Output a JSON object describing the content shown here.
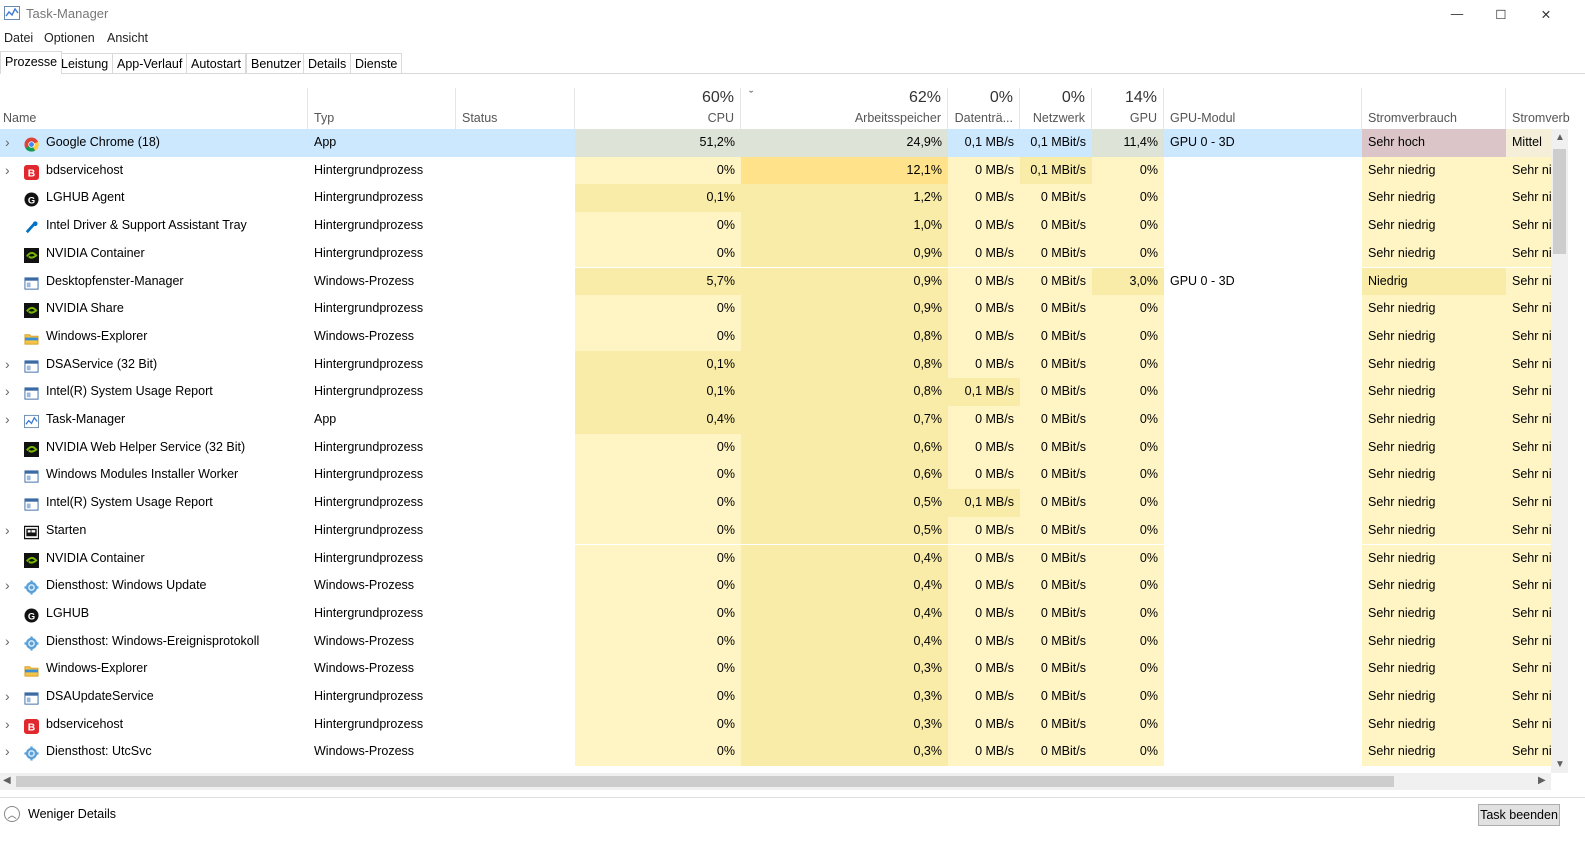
{
  "window": {
    "title": "Task-Manager",
    "minimize": "—",
    "maximize": "☐",
    "close": "✕"
  },
  "menu": [
    "Datei",
    "Optionen",
    "Ansicht"
  ],
  "tabs": [
    "Prozesse",
    "Leistung",
    "App-Verlauf",
    "Autostart",
    "Benutzer",
    "Details",
    "Dienste"
  ],
  "header": {
    "name": "Name",
    "type": "Typ",
    "status": "Status",
    "cpu_pct": "60%",
    "cpu": "CPU",
    "sort_indicator": "ˇ",
    "mem_pct": "62%",
    "mem": "Arbeitsspeicher",
    "disk_pct": "0%",
    "disk": "Datenträ...",
    "net_pct": "0%",
    "net": "Netzwerk",
    "gpu_pct": "14%",
    "gpu": "GPU",
    "gpu_engine": "GPU-Modul",
    "power": "Stromverbrauch",
    "power_trend": "Stromverb"
  },
  "rows": [
    {
      "expand": true,
      "icon": "chrome-icon",
      "name": "Google Chrome (18)",
      "type": "App",
      "cpu": "51,2%",
      "mem": "24,9%",
      "disk": "0,1 MB/s",
      "net": "0,1 MBit/s",
      "gpu": "11,4%",
      "engine": "GPU 0 - 3D",
      "power": "Sehr hoch",
      "trend": "Mittel",
      "selected": true
    },
    {
      "expand": true,
      "icon": "bitdefender-icon",
      "name": "bdservicehost",
      "type": "Hintergrundprozess",
      "cpu": "0%",
      "mem": "12,1%",
      "disk": "0 MB/s",
      "net": "0,1 MBit/s",
      "gpu": "0%",
      "engine": "",
      "power": "Sehr niedrig",
      "trend": "Sehr nie"
    },
    {
      "expand": false,
      "icon": "logitech-icon",
      "name": "LGHUB Agent",
      "type": "Hintergrundprozess",
      "cpu": "0,1%",
      "mem": "1,2%",
      "disk": "0 MB/s",
      "net": "0 MBit/s",
      "gpu": "0%",
      "engine": "",
      "power": "Sehr niedrig",
      "trend": "Sehr nie"
    },
    {
      "expand": false,
      "icon": "intel-tray-icon",
      "name": "Intel Driver & Support Assistant Tray",
      "type": "Hintergrundprozess",
      "cpu": "0%",
      "mem": "1,0%",
      "disk": "0 MB/s",
      "net": "0 MBit/s",
      "gpu": "0%",
      "engine": "",
      "power": "Sehr niedrig",
      "trend": "Sehr nie"
    },
    {
      "expand": false,
      "icon": "nvidia-icon",
      "name": "NVIDIA Container",
      "type": "Hintergrundprozess",
      "cpu": "0%",
      "mem": "0,9%",
      "disk": "0 MB/s",
      "net": "0 MBit/s",
      "gpu": "0%",
      "engine": "",
      "power": "Sehr niedrig",
      "trend": "Sehr nie"
    },
    {
      "expand": false,
      "icon": "window-icon",
      "name": "Desktopfenster-Manager",
      "type": "Windows-Prozess",
      "cpu": "5,7%",
      "mem": "0,9%",
      "disk": "0 MB/s",
      "net": "0 MBit/s",
      "gpu": "3,0%",
      "engine": "GPU 0 - 3D",
      "power": "Niedrig",
      "trend": "Sehr nie"
    },
    {
      "expand": false,
      "icon": "nvidia-icon",
      "name": "NVIDIA Share",
      "type": "Hintergrundprozess",
      "cpu": "0%",
      "mem": "0,9%",
      "disk": "0 MB/s",
      "net": "0 MBit/s",
      "gpu": "0%",
      "engine": "",
      "power": "Sehr niedrig",
      "trend": "Sehr nie"
    },
    {
      "expand": false,
      "icon": "folder-icon",
      "name": "Windows-Explorer",
      "type": "Windows-Prozess",
      "cpu": "0%",
      "mem": "0,8%",
      "disk": "0 MB/s",
      "net": "0 MBit/s",
      "gpu": "0%",
      "engine": "",
      "power": "Sehr niedrig",
      "trend": "Sehr nie"
    },
    {
      "expand": true,
      "icon": "window-icon",
      "name": "DSAService (32 Bit)",
      "type": "Hintergrundprozess",
      "cpu": "0,1%",
      "mem": "0,8%",
      "disk": "0 MB/s",
      "net": "0 MBit/s",
      "gpu": "0%",
      "engine": "",
      "power": "Sehr niedrig",
      "trend": "Sehr nie"
    },
    {
      "expand": true,
      "icon": "window-icon",
      "name": "Intel(R) System Usage Report",
      "type": "Hintergrundprozess",
      "cpu": "0,1%",
      "mem": "0,8%",
      "disk": "0,1 MB/s",
      "net": "0 MBit/s",
      "gpu": "0%",
      "engine": "",
      "power": "Sehr niedrig",
      "trend": "Sehr nie"
    },
    {
      "expand": true,
      "icon": "taskmgr-icon",
      "name": "Task-Manager",
      "type": "App",
      "cpu": "0,4%",
      "mem": "0,7%",
      "disk": "0 MB/s",
      "net": "0 MBit/s",
      "gpu": "0%",
      "engine": "",
      "power": "Sehr niedrig",
      "trend": "Sehr nie"
    },
    {
      "expand": false,
      "icon": "nvidia-icon",
      "name": "NVIDIA Web Helper Service (32 Bit)",
      "type": "Hintergrundprozess",
      "cpu": "0%",
      "mem": "0,6%",
      "disk": "0 MB/s",
      "net": "0 MBit/s",
      "gpu": "0%",
      "engine": "",
      "power": "Sehr niedrig",
      "trend": "Sehr nie"
    },
    {
      "expand": false,
      "icon": "window-icon",
      "name": "Windows Modules Installer Worker",
      "type": "Hintergrundprozess",
      "cpu": "0%",
      "mem": "0,6%",
      "disk": "0 MB/s",
      "net": "0 MBit/s",
      "gpu": "0%",
      "engine": "",
      "power": "Sehr niedrig",
      "trend": "Sehr nie"
    },
    {
      "expand": false,
      "icon": "window-icon",
      "name": "Intel(R) System Usage Report",
      "type": "Hintergrundprozess",
      "cpu": "0%",
      "mem": "0,5%",
      "disk": "0,1 MB/s",
      "net": "0 MBit/s",
      "gpu": "0%",
      "engine": "",
      "power": "Sehr niedrig",
      "trend": "Sehr nie"
    },
    {
      "expand": true,
      "icon": "start-icon",
      "name": "Starten",
      "type": "Hintergrundprozess",
      "cpu": "0%",
      "mem": "0,5%",
      "disk": "0 MB/s",
      "net": "0 MBit/s",
      "gpu": "0%",
      "engine": "",
      "power": "Sehr niedrig",
      "trend": "Sehr nie"
    },
    {
      "expand": false,
      "icon": "nvidia-icon",
      "name": "NVIDIA Container",
      "type": "Hintergrundprozess",
      "cpu": "0%",
      "mem": "0,4%",
      "disk": "0 MB/s",
      "net": "0 MBit/s",
      "gpu": "0%",
      "engine": "",
      "power": "Sehr niedrig",
      "trend": "Sehr nie"
    },
    {
      "expand": true,
      "icon": "gear-icon",
      "name": "Diensthost: Windows Update",
      "type": "Windows-Prozess",
      "cpu": "0%",
      "mem": "0,4%",
      "disk": "0 MB/s",
      "net": "0 MBit/s",
      "gpu": "0%",
      "engine": "",
      "power": "Sehr niedrig",
      "trend": "Sehr nie"
    },
    {
      "expand": false,
      "icon": "logitech-icon",
      "name": "LGHUB",
      "type": "Hintergrundprozess",
      "cpu": "0%",
      "mem": "0,4%",
      "disk": "0 MB/s",
      "net": "0 MBit/s",
      "gpu": "0%",
      "engine": "",
      "power": "Sehr niedrig",
      "trend": "Sehr nie"
    },
    {
      "expand": true,
      "icon": "gear-icon",
      "name": "Diensthost: Windows-Ereignisprotokoll",
      "type": "Windows-Prozess",
      "cpu": "0%",
      "mem": "0,4%",
      "disk": "0 MB/s",
      "net": "0 MBit/s",
      "gpu": "0%",
      "engine": "",
      "power": "Sehr niedrig",
      "trend": "Sehr nie"
    },
    {
      "expand": false,
      "icon": "folder-icon",
      "name": "Windows-Explorer",
      "type": "Windows-Prozess",
      "cpu": "0%",
      "mem": "0,3%",
      "disk": "0 MB/s",
      "net": "0 MBit/s",
      "gpu": "0%",
      "engine": "",
      "power": "Sehr niedrig",
      "trend": "Sehr nie"
    },
    {
      "expand": true,
      "icon": "window-icon",
      "name": "DSAUpdateService",
      "type": "Hintergrundprozess",
      "cpu": "0%",
      "mem": "0,3%",
      "disk": "0 MB/s",
      "net": "0 MBit/s",
      "gpu": "0%",
      "engine": "",
      "power": "Sehr niedrig",
      "trend": "Sehr nie"
    },
    {
      "expand": true,
      "icon": "bitdefender-icon",
      "name": "bdservicehost",
      "type": "Hintergrundprozess",
      "cpu": "0%",
      "mem": "0,3%",
      "disk": "0 MB/s",
      "net": "0 MBit/s",
      "gpu": "0%",
      "engine": "",
      "power": "Sehr niedrig",
      "trend": "Sehr nie"
    },
    {
      "expand": true,
      "icon": "gear-icon",
      "name": "Diensthost: UtcSvc",
      "type": "Windows-Prozess",
      "cpu": "0%",
      "mem": "0,3%",
      "disk": "0 MB/s",
      "net": "0 MBit/s",
      "gpu": "0%",
      "engine": "",
      "power": "Sehr niedrig",
      "trend": "Sehr nie"
    }
  ],
  "footer": {
    "less_details": "Weniger Details",
    "end_task": "Task beenden"
  },
  "colors": {
    "heat_light": "#fff4c4",
    "heat_mid": "#f9eca8",
    "heat_high": "#ffe28a",
    "power_very_high": "#dcc5c9",
    "selected": "#cce8ff"
  }
}
